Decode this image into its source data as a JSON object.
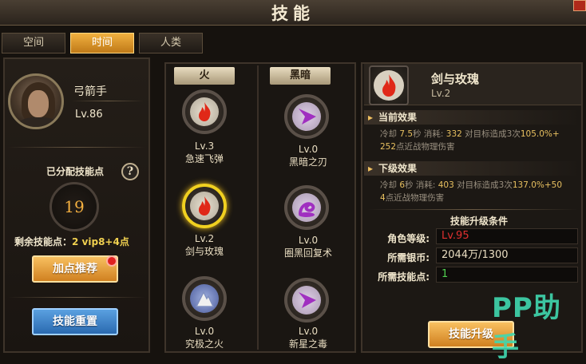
{
  "header": {
    "title": "技能"
  },
  "tabs": [
    {
      "label": "空间",
      "active": false
    },
    {
      "label": "时间",
      "active": true
    },
    {
      "label": "人类",
      "active": false
    }
  ],
  "hero": {
    "class_name": "弓箭手",
    "level": "Lv.86",
    "allocated_label": "已分配技能点",
    "allocated_points": "19",
    "remaining_label": "剩余技能点：",
    "remaining_value": "2 vip8+4点",
    "recommend_button": "加点推荐",
    "reset_button": "技能重置"
  },
  "skill_columns": [
    {
      "header": "火",
      "skills": [
        {
          "level": "Lv.3",
          "name": "急速飞弹",
          "icon": "fire-icon"
        },
        {
          "level": "Lv.2",
          "name": "剑与玫瑰",
          "icon": "fire-icon",
          "selected": true
        },
        {
          "level": "Lv.0",
          "name": "究极之火",
          "icon": "mountain-icon"
        }
      ]
    },
    {
      "header": "黑暗",
      "skills": [
        {
          "level": "Lv.0",
          "name": "黑暗之刃",
          "icon": "dark-blade-icon"
        },
        {
          "level": "Lv.0",
          "name": "圈黑回复术",
          "icon": "dark-spiral-icon"
        },
        {
          "level": "Lv.0",
          "name": "新星之毒",
          "icon": "dark-blade-icon"
        }
      ]
    }
  ],
  "selected_skill": {
    "name": "剑与玫瑰",
    "level": "Lv.2",
    "current_label": "当前效果",
    "current_effect_prefix": "冷却 ",
    "current_cd": "7.5",
    "current_mid1": "秒 消耗: ",
    "current_cost": "332",
    "current_mid2": " 对目标造成3次",
    "current_pct": "105.0%+",
    "current_bonus": "252",
    "current_suffix": "点近战物理伤害",
    "next_label": "下级效果",
    "next_effect_prefix": "冷却 ",
    "next_cd": "6",
    "next_mid1": "秒 消耗: ",
    "next_cost": "403",
    "next_mid2": " 对目标造成3次",
    "next_pct": "137.0%+50",
    "next_bonus": "4",
    "next_suffix": "点近战物理伤害"
  },
  "upgrade_conditions": {
    "title": "技能升级条件",
    "rows": [
      {
        "label": "角色等级:",
        "value": "Lv.95",
        "color": "#e03030"
      },
      {
        "label": "所需银币:",
        "value": "2044万/1300",
        "color": "#e8dcc0"
      },
      {
        "label": "所需技能点:",
        "value": "1",
        "color": "#50d050"
      }
    ],
    "upgrade_button": "技能升级"
  },
  "watermark": "PP助手",
  "colors": {
    "accent_orange": "#f0b040",
    "fire_red": "#e02818",
    "dark_purple": "#a030c0"
  }
}
